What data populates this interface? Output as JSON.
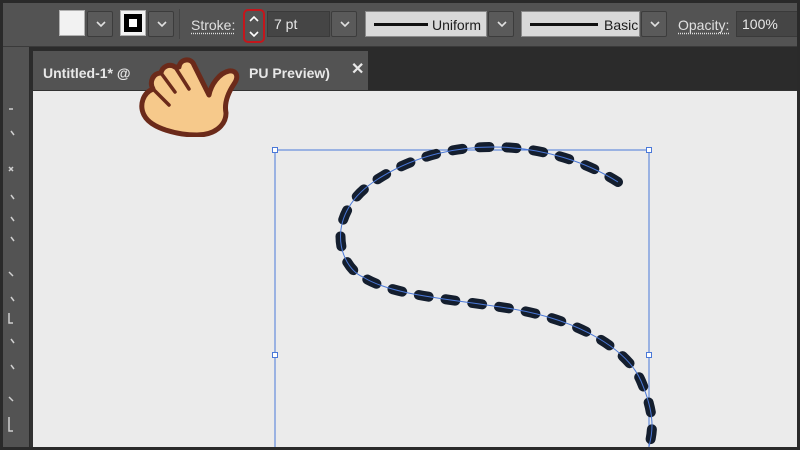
{
  "control_bar": {
    "fill_label": "Fill",
    "stroke_label": "Stroke:",
    "stroke_weight": "7 pt",
    "variable_width_profile": "Uniform",
    "brush_definition": "Basic",
    "opacity_label": "Opacity:",
    "opacity_value": "100%"
  },
  "document_tab": {
    "title_start": "Untitled-1* @",
    "title_end": "PU Preview)",
    "close_glyph": "✕"
  },
  "colors": {
    "panel_bg": "#535353",
    "canvas_bg": "#ebebeb",
    "selection_blue": "#4a78d8",
    "stroke_dash": "#141e2e",
    "highlight_red": "#c4161c",
    "hand_skin": "#f6c98b"
  },
  "icons": {
    "spinner_up": "chevron-up-icon",
    "spinner_down": "chevron-down-icon",
    "pointer": "hand-pointer-icon"
  }
}
